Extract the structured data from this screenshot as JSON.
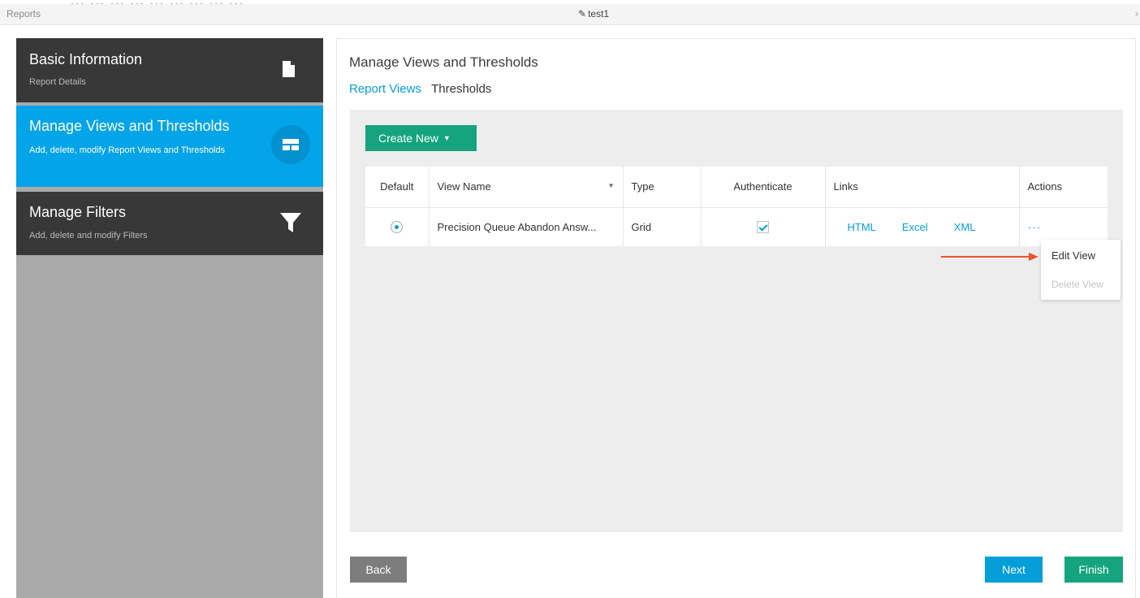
{
  "caption": "... ... ... ... ... ... ... ... ...",
  "header": {
    "breadcrumb": "Reports",
    "report_name": "test1",
    "close_glyph": "›"
  },
  "steps": [
    {
      "title": "Basic Information",
      "subtitle": "Report Details",
      "icon": "document-icon",
      "active": false
    },
    {
      "title": "Manage Views and Thresholds",
      "subtitle": "Add, delete, modify Report Views and Thresholds",
      "icon": "views-layout-icon",
      "active": true
    },
    {
      "title": "Manage Filters",
      "subtitle": "Add, delete and modify Filters",
      "icon": "filter-icon",
      "active": false
    }
  ],
  "main": {
    "title": "Manage Views and Thresholds",
    "tabs": [
      {
        "label": "Report Views",
        "active": true
      },
      {
        "label": "Thresholds",
        "active": false
      }
    ],
    "create_new_label": "Create New",
    "table": {
      "columns": [
        "Default",
        "View Name",
        "Type",
        "Authenticate",
        "Links",
        "Actions"
      ],
      "rows": [
        {
          "default": true,
          "view_name": "Precision Queue Abandon Answ...",
          "type": "Grid",
          "authenticate": true,
          "links": [
            "HTML",
            "Excel",
            "XML"
          ],
          "actions": "···"
        }
      ]
    },
    "actions_menu": [
      "Edit View",
      "Delete View"
    ],
    "buttons": {
      "back": "Back",
      "next": "Next",
      "finish": "Finish"
    }
  },
  "colors": {
    "accent_blue": "#049fd9",
    "active_step": "#04a4e8",
    "green": "#15a47e",
    "dark_step": "#383838",
    "annotation_arrow": "#f0512f"
  }
}
